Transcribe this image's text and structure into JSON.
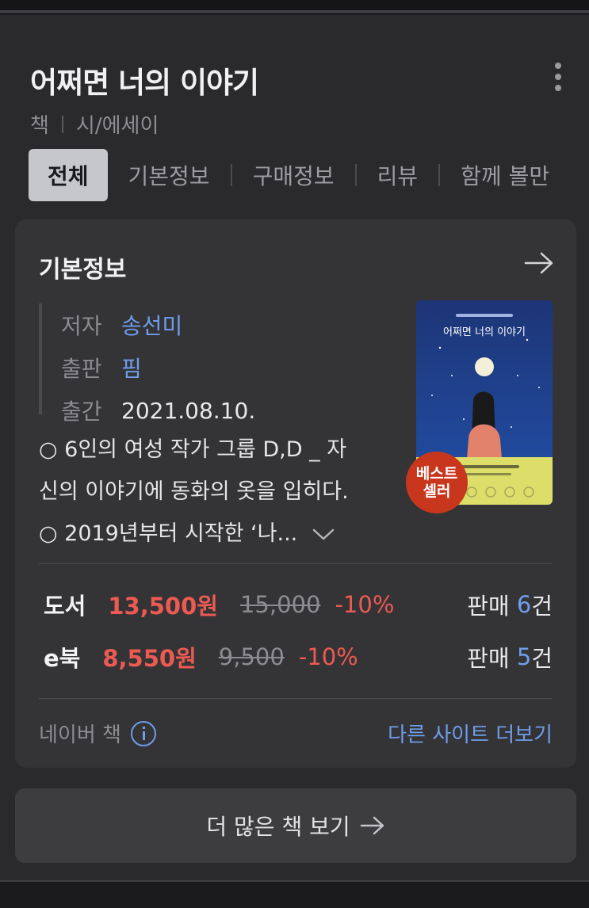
{
  "header": {
    "title": "어쩌면 너의 이야기",
    "category_main": "책",
    "category_sub": "시/에세이"
  },
  "tabs": [
    {
      "label": "전체",
      "active": true
    },
    {
      "label": "기본정보",
      "active": false
    },
    {
      "label": "구매정보",
      "active": false
    },
    {
      "label": "리뷰",
      "active": false
    },
    {
      "label": "함께 볼만",
      "active": false
    }
  ],
  "basic_info": {
    "heading": "기본정보",
    "author_label": "저자",
    "author": "송선미",
    "publisher_label": "출판",
    "publisher": "핌",
    "date_label": "출간",
    "date": "2021.08.10.",
    "description_line1": "○ 6인의 여성 작가 그룹 D,D _ 자",
    "description_line2": "신의 이야기에 동화의 옷을 입히다.",
    "description_line3": "○ 2019년부터 시작한 ‘나...",
    "badge_line1": "베스트",
    "badge_line2": "셀러",
    "cover_title": "어쩌면 너의 이야기"
  },
  "prices": [
    {
      "kind": "도서",
      "price": "13,500원",
      "original": "15,000",
      "discount": "-10%",
      "sales_label": "판매",
      "sales_count": "6",
      "sales_unit": "건"
    },
    {
      "kind": "e북",
      "price": "8,550원",
      "original": "9,500",
      "discount": "-10%",
      "sales_label": "판매",
      "sales_count": "5",
      "sales_unit": "건"
    }
  ],
  "footer": {
    "source": "네이버 책",
    "other_sites": "다른 사이트 더보기"
  },
  "more_button": "더 많은 책 보기",
  "colors": {
    "accent_blue": "#6f9dea",
    "price_red": "#ec5a52",
    "badge_red": "#c9361e"
  }
}
